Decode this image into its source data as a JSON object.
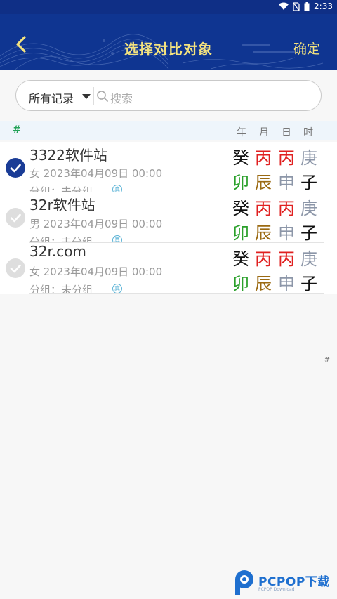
{
  "status": {
    "time": "2:33"
  },
  "header": {
    "title": "选择对比对象",
    "confirm_label": "确定"
  },
  "search": {
    "filter_label": "所有记录",
    "placeholder": "搜索"
  },
  "index": {
    "letter": "#",
    "columns": [
      "年",
      "月",
      "日",
      "时"
    ]
  },
  "records": [
    {
      "name": "3322软件站",
      "info": "女 2023年04月09日 00:00",
      "group": "分组：未分组",
      "tag": "真",
      "checked": true,
      "stems": [
        "癸",
        "丙",
        "丙",
        "庚"
      ],
      "branches": [
        "卯",
        "辰",
        "申",
        "子"
      ]
    },
    {
      "name": "32r软件站",
      "info": "男 2023年04月09日 00:00",
      "group": "分组：未分组",
      "tag": "真",
      "checked": false,
      "stems": [
        "癸",
        "丙",
        "丙",
        "庚"
      ],
      "branches": [
        "卯",
        "辰",
        "申",
        "子"
      ]
    },
    {
      "name": "32r.com",
      "info": "女 2023年04月09日 00:00",
      "group": "分组：未分组",
      "tag": "真",
      "checked": false,
      "stems": [
        "癸",
        "丙",
        "丙",
        "庚"
      ],
      "branches": [
        "卯",
        "辰",
        "申",
        "子"
      ]
    }
  ],
  "side_index": "#",
  "watermark": {
    "brand": "PCPOP下载",
    "sub": "PCPOP Download"
  },
  "colors": {
    "header_bg": "#0f3591",
    "title": "#f3e27f",
    "check_on": "#1a3c96",
    "fire_red": "#e02020",
    "metal_gray": "#8c96a8",
    "wood_green": "#2aa02a",
    "earth_brown": "#9b6a12",
    "water_black": "#111111"
  }
}
